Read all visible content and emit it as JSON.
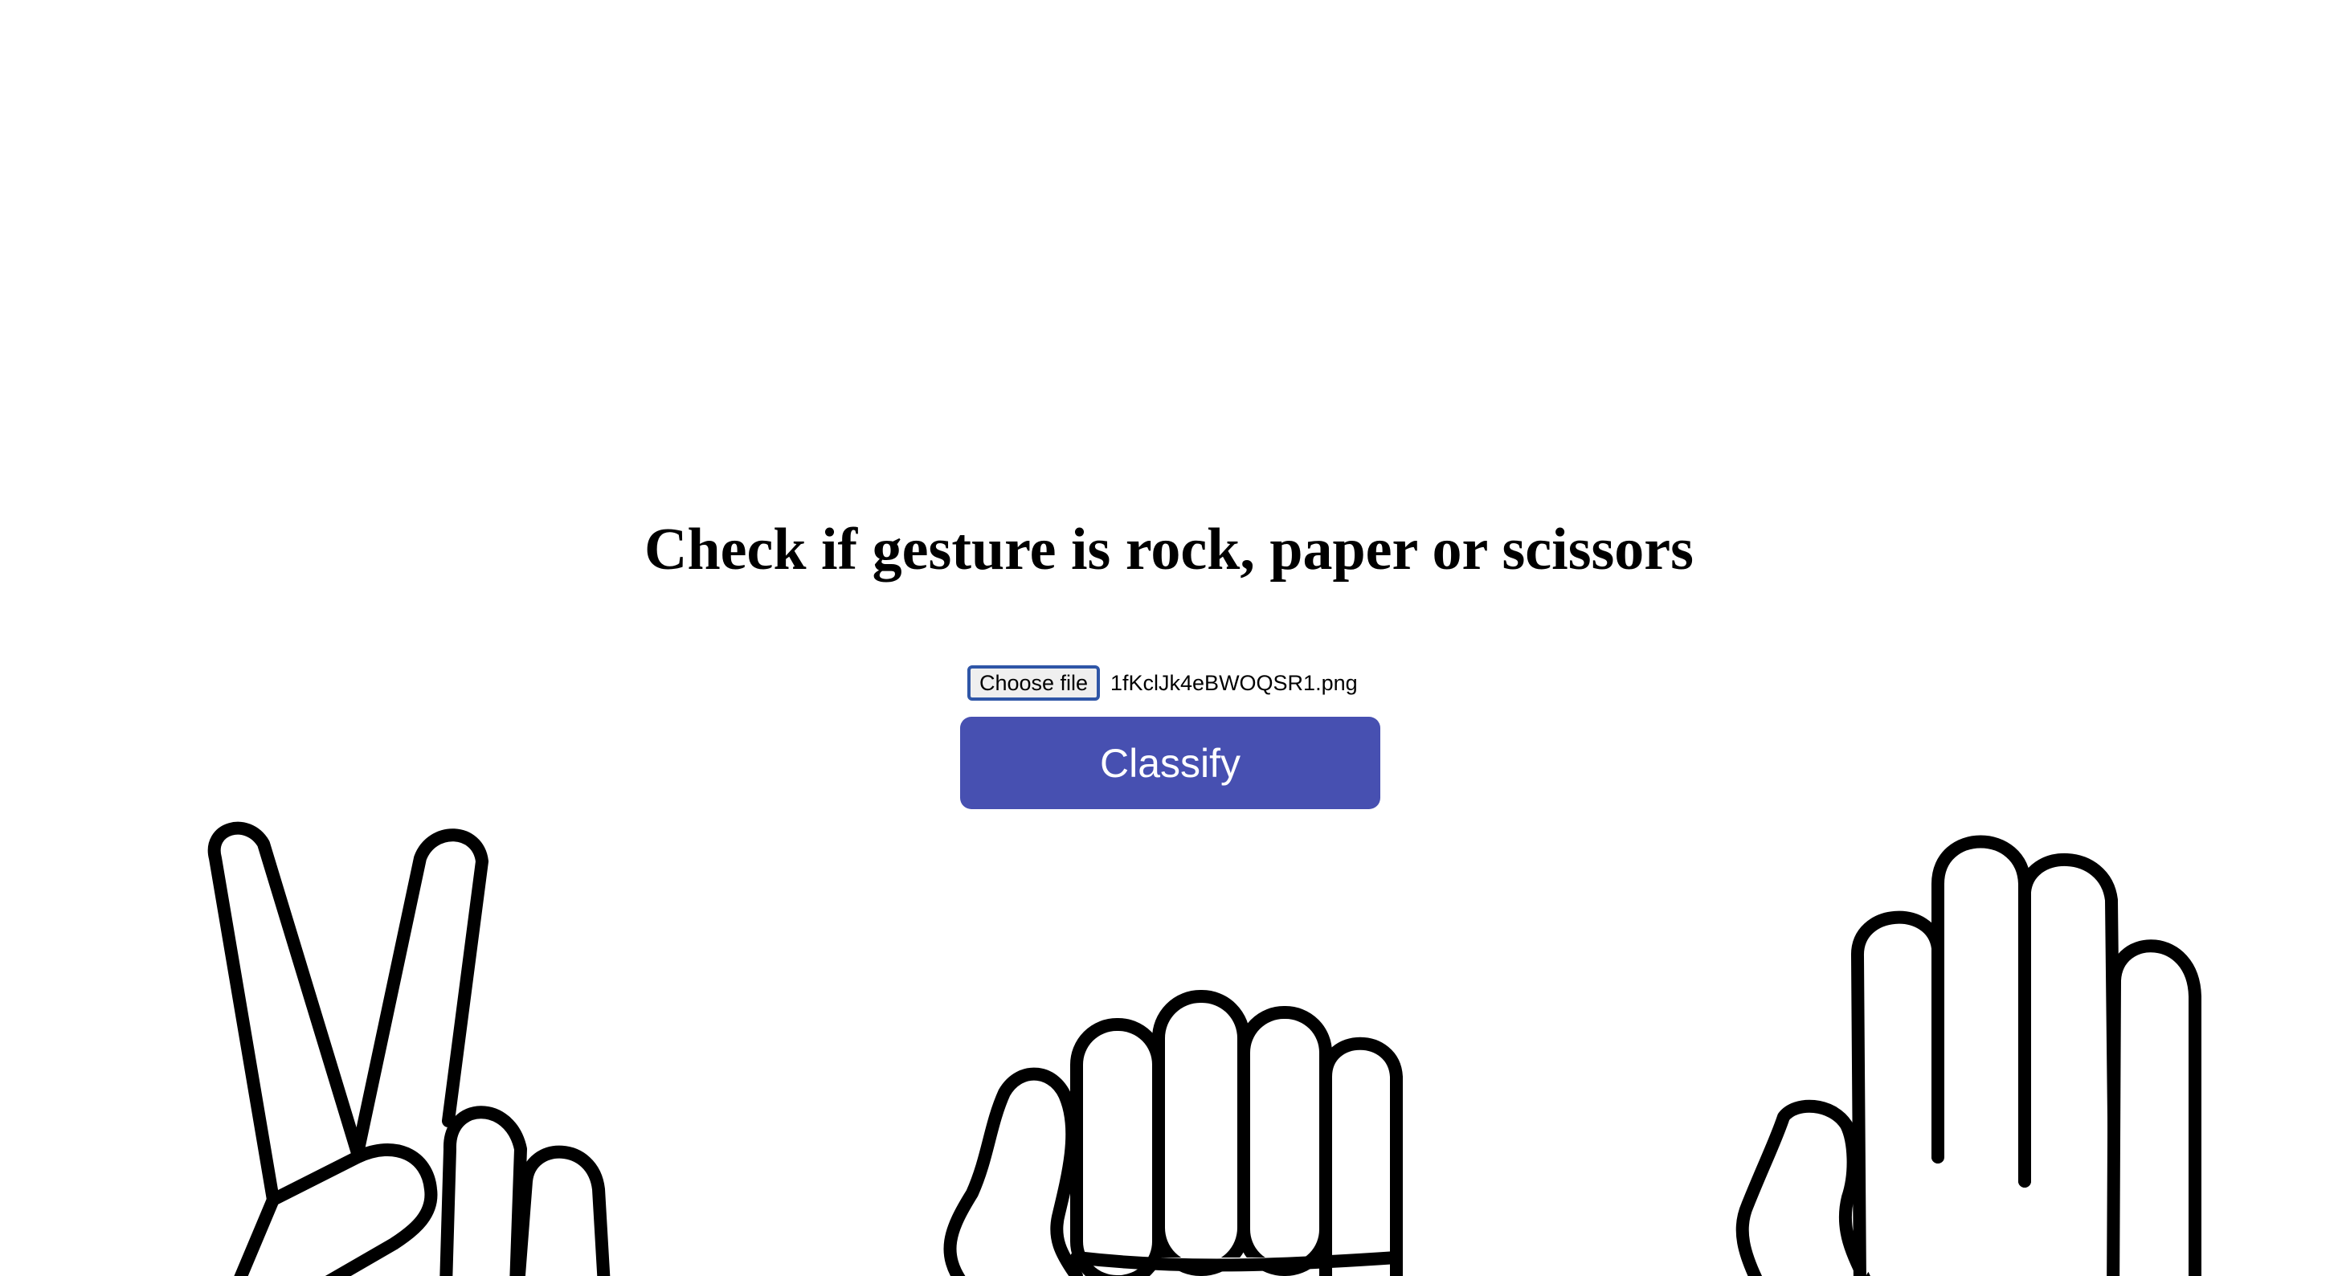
{
  "page": {
    "title": "Check if gesture is rock, paper or scissors"
  },
  "upload": {
    "choose_label": "Choose file",
    "file_name": "1fKclJk4eBWOQSR1.png"
  },
  "actions": {
    "classify_label": "Classify"
  },
  "colors": {
    "accent": "#4750b1",
    "focus_ring": "#2f56a7",
    "background": "#ffffff",
    "text": "#000000"
  },
  "illustrations": [
    {
      "icon": "scissors-hand-icon"
    },
    {
      "icon": "rock-fist-icon"
    },
    {
      "icon": "paper-hand-icon"
    }
  ]
}
